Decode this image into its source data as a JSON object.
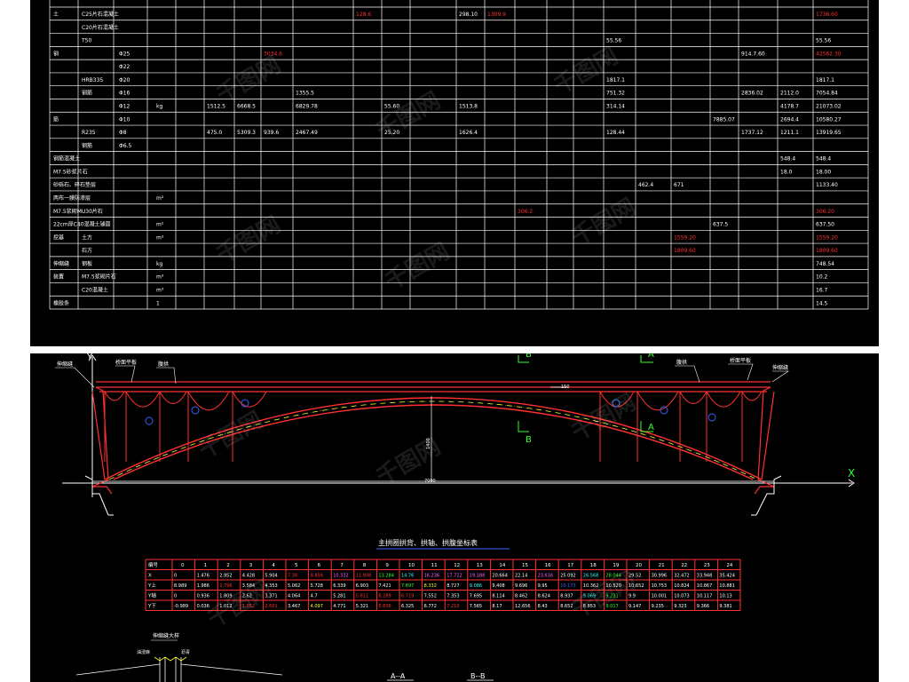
{
  "top_table": {
    "col_x": [
      56,
      88,
      128,
      166,
      198,
      230,
      264,
      294,
      330,
      398,
      430,
      462,
      514,
      546,
      580,
      616,
      646,
      680,
      716,
      756,
      800,
      832,
      876,
      916,
      978
    ],
    "rows": [
      {
        "c0": "土",
        "c1": "C25片石混凝土",
        "vals": [
          {
            "col": 9,
            "v": "128.6",
            "color": "#ff3030"
          },
          {
            "col": 12,
            "v": "298.10",
            "color": "#ffffff"
          },
          {
            "col": 13,
            "v": "1309.9",
            "color": "#ff3030"
          },
          {
            "col": 23,
            "v": "1736.60",
            "color": "#ff3030"
          }
        ]
      },
      {
        "c0": "",
        "c1": "C20片石混凝土",
        "vals": []
      },
      {
        "c0": "",
        "c1": "T50",
        "vals": [
          {
            "col": 17,
            "v": "55.56",
            "color": "#ffffff"
          },
          {
            "col": 23,
            "v": "55.56",
            "color": "#ffffff"
          }
        ]
      },
      {
        "c0": "钢",
        "c1": "",
        "c2": "Φ25",
        "vals": [
          {
            "col": 7,
            "v": "3034.6",
            "color": "#ff3030"
          },
          {
            "col": 21,
            "v": "914.7.60",
            "color": "#ffffff"
          },
          {
            "col": 23,
            "v": "42562.30",
            "color": "#ff3030"
          }
        ]
      },
      {
        "c0": "",
        "c1": "",
        "c2": "Φ22",
        "vals": []
      },
      {
        "c0": "",
        "c1": "HRB335",
        "c2": "Φ20",
        "vals": [
          {
            "col": 17,
            "v": "1817.1",
            "color": "#ffffff"
          },
          {
            "col": 23,
            "v": "1817.1",
            "color": "#ffffff"
          }
        ]
      },
      {
        "c0": "",
        "c1": "钢筋",
        "c2": "Φ16",
        "vals": [
          {
            "col": 8,
            "v": "1355.5",
            "color": "#ffffff"
          },
          {
            "col": 17,
            "v": "751.32",
            "color": "#ffffff"
          },
          {
            "col": 21,
            "v": "2836.02",
            "color": "#ffffff"
          },
          {
            "col": 22,
            "v": "2112.0",
            "color": "#ffffff"
          },
          {
            "col": 23,
            "v": "7054.84",
            "color": "#ffffff"
          }
        ]
      },
      {
        "c0": "",
        "c1": "",
        "c2": "Φ12",
        "unit": "kg",
        "vals": [
          {
            "col": 5,
            "v": "1512.5",
            "color": "#ffffff"
          },
          {
            "col": 6,
            "v": "6668.5",
            "color": "#ffffff"
          },
          {
            "col": 8,
            "v": "6829.78",
            "color": "#ffffff"
          },
          {
            "col": 10,
            "v": "55.60",
            "color": "#ffffff"
          },
          {
            "col": 12,
            "v": "1513.8",
            "color": "#ffffff"
          },
          {
            "col": 17,
            "v": "314.14",
            "color": "#ffffff"
          },
          {
            "col": 22,
            "v": "4178.7",
            "color": "#ffffff"
          },
          {
            "col": 23,
            "v": "21073.02",
            "color": "#ffffff"
          }
        ]
      },
      {
        "c0": "筋",
        "c1": "",
        "c2": "Φ10",
        "vals": [
          {
            "col": 20,
            "v": "7885.07",
            "color": "#ffffff"
          },
          {
            "col": 22,
            "v": "2694.4",
            "color": "#ffffff"
          },
          {
            "col": 23,
            "v": "10580.27",
            "color": "#ffffff"
          }
        ]
      },
      {
        "c0": "",
        "c1": "R235",
        "c2": "Φ8",
        "vals": [
          {
            "col": 5,
            "v": "475.0",
            "color": "#ffffff"
          },
          {
            "col": 6,
            "v": "5309.3",
            "color": "#ffffff"
          },
          {
            "col": 7,
            "v": "939.6",
            "color": "#ffffff"
          },
          {
            "col": 8,
            "v": "2467.49",
            "color": "#ffffff"
          },
          {
            "col": 10,
            "v": "25.20",
            "color": "#ffffff"
          },
          {
            "col": 12,
            "v": "1626.4",
            "color": "#ffffff"
          },
          {
            "col": 17,
            "v": "128.44",
            "color": "#ffffff"
          },
          {
            "col": 21,
            "v": "1737.12",
            "color": "#ffffff"
          },
          {
            "col": 22,
            "v": "1211.1",
            "color": "#ffffff"
          },
          {
            "col": 23,
            "v": "13919.65",
            "color": "#ffffff"
          }
        ]
      },
      {
        "c0": "",
        "c1": "钢筋",
        "c2": "Φ6.5",
        "vals": []
      },
      {
        "c0": "钢筋混凝土",
        "c1": "",
        "vals": [
          {
            "col": 22,
            "v": "548.4",
            "color": "#ffffff"
          },
          {
            "col": 23,
            "v": "548.4",
            "color": "#ffffff"
          }
        ]
      },
      {
        "c0": "M7.5砂浆片石",
        "c1": "",
        "vals": [
          {
            "col": 22,
            "v": "18.0",
            "color": "#ffffff"
          },
          {
            "col": 23,
            "v": "18.00",
            "color": "#ffffff"
          }
        ]
      },
      {
        "c0": "砂砾石、碎石垫层",
        "c1": "",
        "vals": [
          {
            "col": 18,
            "v": "462.4",
            "color": "#ffffff"
          },
          {
            "col": 19,
            "v": "671",
            "color": "#ffffff"
          },
          {
            "col": 23,
            "v": "1133.40",
            "color": "#ffffff"
          }
        ]
      },
      {
        "c0": "两布一膜防渗层",
        "c1": "",
        "unit": "m²",
        "vals": []
      },
      {
        "c0": "M7.5浆砌MU30片石",
        "c1": "",
        "vals": [
          {
            "col": 14,
            "v": "306.2",
            "color": "#ff3030"
          },
          {
            "col": 23,
            "v": "306.20",
            "color": "#ff3030"
          }
        ]
      },
      {
        "c0": "22cm厚C40混凝土铺面",
        "c1": "",
        "unit": "m²",
        "vals": [
          {
            "col": 20,
            "v": "637.5",
            "color": "#ffffff"
          },
          {
            "col": 23,
            "v": "637.50",
            "color": "#ffffff"
          }
        ]
      },
      {
        "c0": "挖基",
        "c1": "土方",
        "unit": "m³",
        "vals": [
          {
            "col": 19,
            "v": "1559.20",
            "color": "#ff3030"
          },
          {
            "col": 23,
            "v": "1559.20",
            "color": "#ff3030"
          }
        ]
      },
      {
        "c0": "",
        "c1": "石方",
        "vals": [
          {
            "col": 19,
            "v": "1809.60",
            "color": "#ff3030"
          },
          {
            "col": 23,
            "v": "1809.60",
            "color": "#ff3030"
          }
        ]
      },
      {
        "c0": "伸缩缝",
        "c1": "钢板",
        "unit": "kg",
        "vals": [
          {
            "col": 23,
            "v": "748.54",
            "color": "#ffffff"
          }
        ]
      },
      {
        "c0": "装置",
        "c1": "M7.5浆砌片石",
        "unit": "m³",
        "vals": [
          {
            "col": 23,
            "v": "10.2",
            "color": "#ffffff"
          }
        ]
      },
      {
        "c0": "",
        "c1": "C20混凝土",
        "unit": "m³",
        "vals": [
          {
            "col": 23,
            "v": "16.7",
            "color": "#ffffff"
          }
        ]
      },
      {
        "c0": "橡胶条",
        "c1": "",
        "unit": "1",
        "vals": [
          {
            "col": 23,
            "v": "14.5",
            "color": "#ffffff"
          }
        ]
      }
    ]
  },
  "elevation": {
    "labels": {
      "left_joint": "伸缩缝",
      "left_deck_slab": "桥面平板",
      "left_spandrel": "腹拱",
      "right_spandrel": "腹拱",
      "right_deck_slab": "桥面平板",
      "right_joint": "伸缩缝",
      "axis_y": "Y",
      "axis_x": "X",
      "section_a": "A",
      "section_b": "B",
      "span": "7000",
      "rise": "1400",
      "crown": "150"
    }
  },
  "coord_table": {
    "title": "主拱圈拱背、拱轴、拱腹坐标表",
    "header_label": "编号",
    "row_labels": [
      "X",
      "Y上",
      "Y轴",
      "Y下"
    ],
    "columns": [
      "0",
      "1",
      "2",
      "3",
      "4",
      "5",
      "6",
      "7",
      "8",
      "9",
      "10",
      "11",
      "12",
      "13",
      "14",
      "15",
      "16",
      "17",
      "18",
      "19",
      "20",
      "21",
      "22",
      "23",
      "24"
    ],
    "X": [
      "0",
      "1.476",
      "2.952",
      "4.428",
      "5.904",
      "7.38",
      "8.856",
      "10.332",
      "11.808",
      "13.284",
      "14.76",
      "16.236",
      "17.712",
      "19.188",
      "20.664",
      "22.14",
      "23.616",
      "25.092",
      "26.568",
      "28.044",
      "29.52",
      "30.996",
      "32.472",
      "33.948",
      "35.424"
    ],
    "Y上": [
      "8.989",
      "1.986",
      "2.796",
      "3.584",
      "4.353",
      "5.062",
      "5.728",
      "6.339",
      "6.903",
      "7.421",
      "7.897",
      "8.332",
      "8.727",
      "9.086",
      "9.408",
      "9.696",
      "9.95",
      "10.173",
      "10.362",
      "10.520",
      "10.652",
      "10.753",
      "10.824",
      "10.867",
      "10.881"
    ],
    "Y轴": [
      "0",
      "0.936",
      "1.809",
      "2.62",
      "3.371",
      "4.064",
      "4.7",
      "5.281",
      "5.811",
      "6.289",
      "6.719",
      "7.552",
      "7.353",
      "7.695",
      "8.114",
      "8.462",
      "8.624",
      "8.937",
      "9.069",
      "9.231",
      "9.9",
      "10.001",
      "10.073",
      "10.117",
      "10.13"
    ],
    "Y下": [
      "-0.989",
      "0.036",
      "1.012",
      "1.852",
      "2.601",
      "3.467",
      "4.097",
      "4.771",
      "5.321",
      "5.836",
      "6.325",
      "6.772",
      "7.210",
      "7.565",
      "8.17",
      "12.656",
      "8.43",
      "8.652",
      "8.853",
      "9.017",
      "9.147",
      "9.235",
      "9.323",
      "9.366",
      "9.381"
    ],
    "highlight": {
      "X": {
        "5": "#ff3030",
        "6": "#ff3030",
        "7": "#ff66ff",
        "8": "#ff3030",
        "9": "#33ff33",
        "10": "#33ffff",
        "11": "#ff66ff",
        "12": "#ff66ff",
        "13": "#ff66ff",
        "16": "#ff66ff",
        "18": "#33ffff",
        "19": "#33ff33"
      },
      "Y上": {
        "2": "#ff3030",
        "10": "#33ff33",
        "11": "#ffff33",
        "13": "#33ffff",
        "17": "#3366ff"
      },
      "Y轴": {
        "8": "#ff3030",
        "9": "#ff3030",
        "10": "#ff3030",
        "18": "#33ffff",
        "19": "#33ff33"
      },
      "Y下": {
        "3": "#ff3030",
        "4": "#ff3030",
        "6": "#ffff33",
        "9": "#ff3030",
        "12": "#ff3030",
        "19": "#33ff33"
      }
    }
  },
  "detail": {
    "title": "伸缩缝大样",
    "label_left": "油浸麻",
    "label_right": "沥青",
    "section_aa": "A--A",
    "section_bb": "B--B"
  },
  "watermark": "千图网"
}
